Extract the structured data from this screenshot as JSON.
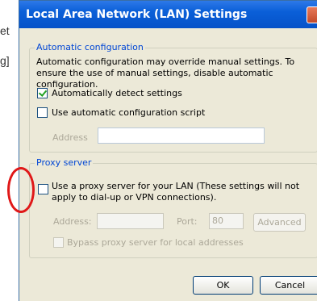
{
  "background": {
    "fragment1": "et",
    "fragment2": "g]"
  },
  "dialog": {
    "title": "Local Area Network (LAN) Settings"
  },
  "auto_config": {
    "title": "Automatic configuration",
    "description": "Automatic configuration may override manual settings.  To ensure the use of manual settings, disable automatic configuration.",
    "detect_label": "Automatically detect settings",
    "detect_checked": true,
    "script_label": "Use automatic configuration script",
    "script_checked": false,
    "address_label": "Address"
  },
  "proxy": {
    "title": "Proxy server",
    "use_proxy_label": "Use a proxy server for your LAN (These settings will not apply to dial-up or VPN connections).",
    "use_proxy_checked": false,
    "address_label": "Address:",
    "port_label": "Port:",
    "port_value": "80",
    "advanced_label": "Advanced",
    "bypass_label": "Bypass proxy server for local addresses"
  },
  "buttons": {
    "ok": "OK",
    "cancel": "Cancel"
  },
  "colors": {
    "title_bar": "#0a5fd8",
    "group_title": "#0046d5",
    "highlight_circle": "#e01818"
  }
}
